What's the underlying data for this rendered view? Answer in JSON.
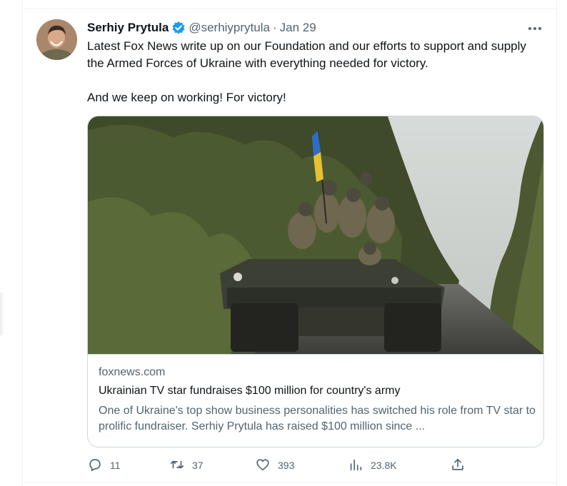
{
  "tweet": {
    "author_name": "Serhiy Prytula",
    "handle": "@serhiyprytula",
    "separator": "·",
    "date": "Jan 29",
    "text_lines": [
      "Latest Fox News write up on our Foundation and our efforts to support and supply the Armed Forces of Ukraine with everything needed for victory.",
      "And we keep on working! For victory!"
    ]
  },
  "card": {
    "domain": "foxnews.com",
    "title": "Ukrainian TV star fundraises $100 million for country's army",
    "description": "One of Ukraine's top show business personalities has switched his role from TV star to prolific fundraiser. Serhiy Prytula has raised $100 million since ..."
  },
  "actions": {
    "reply": "11",
    "retweet": "37",
    "like": "393",
    "views": "23.8K"
  },
  "colors": {
    "accent": "#1d9bf0",
    "text_primary": "#0f1419",
    "text_secondary": "#536471",
    "border": "#cfd9de"
  },
  "icons": {
    "verified": "verified-badge-icon",
    "more": "more-icon",
    "reply": "reply-icon",
    "retweet": "retweet-icon",
    "like": "heart-icon",
    "views": "views-icon",
    "share": "share-icon"
  }
}
